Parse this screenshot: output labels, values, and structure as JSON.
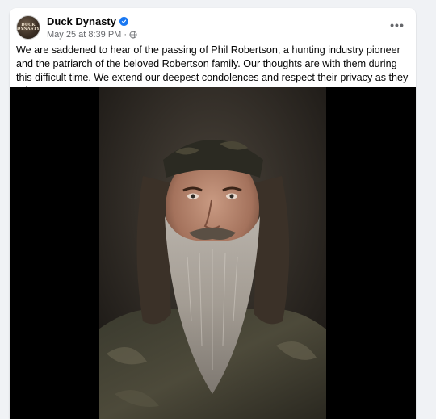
{
  "post": {
    "page_name": "Duck Dynasty",
    "avatar_text_line1": "DUCK",
    "avatar_text_line2": "DYNASTY",
    "timestamp": "May 25 at 8:39 PM",
    "separator": "·",
    "more_label": "•••",
    "body": "We are saddened to hear of the passing of Phil Robertson, a hunting industry pioneer and the patriarch of the beloved Robertson family.  Our thoughts are with them during this difficult time. We extend our deepest condolences and respect their privacy as they grieve."
  },
  "icons": {
    "verified": "verified-badge-icon",
    "audience": "globe-icon",
    "more": "more-options-icon"
  },
  "colors": {
    "verified_blue": "#1877f2",
    "secondary_text": "#65676b",
    "primary_text": "#050505"
  }
}
